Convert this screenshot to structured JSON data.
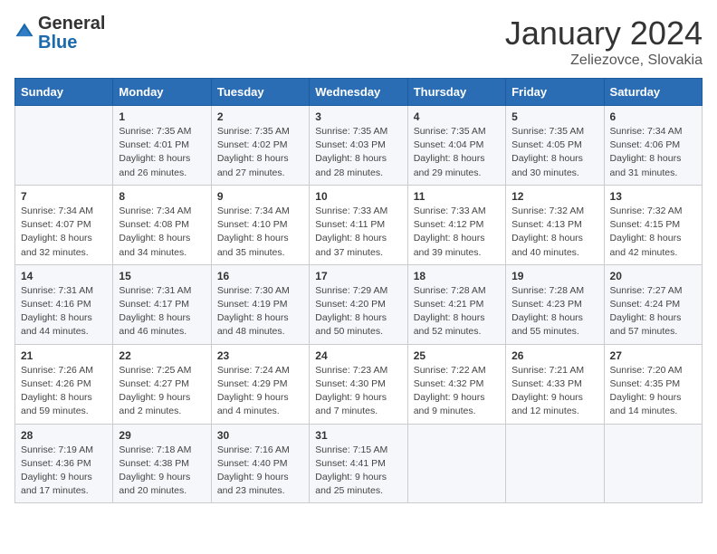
{
  "header": {
    "logo_general": "General",
    "logo_blue": "Blue",
    "month_title": "January 2024",
    "location": "Zeliezovce, Slovakia"
  },
  "days_of_week": [
    "Sunday",
    "Monday",
    "Tuesday",
    "Wednesday",
    "Thursday",
    "Friday",
    "Saturday"
  ],
  "weeks": [
    [
      {
        "day": "",
        "info": ""
      },
      {
        "day": "1",
        "info": "Sunrise: 7:35 AM\nSunset: 4:01 PM\nDaylight: 8 hours\nand 26 minutes."
      },
      {
        "day": "2",
        "info": "Sunrise: 7:35 AM\nSunset: 4:02 PM\nDaylight: 8 hours\nand 27 minutes."
      },
      {
        "day": "3",
        "info": "Sunrise: 7:35 AM\nSunset: 4:03 PM\nDaylight: 8 hours\nand 28 minutes."
      },
      {
        "day": "4",
        "info": "Sunrise: 7:35 AM\nSunset: 4:04 PM\nDaylight: 8 hours\nand 29 minutes."
      },
      {
        "day": "5",
        "info": "Sunrise: 7:35 AM\nSunset: 4:05 PM\nDaylight: 8 hours\nand 30 minutes."
      },
      {
        "day": "6",
        "info": "Sunrise: 7:34 AM\nSunset: 4:06 PM\nDaylight: 8 hours\nand 31 minutes."
      }
    ],
    [
      {
        "day": "7",
        "info": "Sunrise: 7:34 AM\nSunset: 4:07 PM\nDaylight: 8 hours\nand 32 minutes."
      },
      {
        "day": "8",
        "info": "Sunrise: 7:34 AM\nSunset: 4:08 PM\nDaylight: 8 hours\nand 34 minutes."
      },
      {
        "day": "9",
        "info": "Sunrise: 7:34 AM\nSunset: 4:10 PM\nDaylight: 8 hours\nand 35 minutes."
      },
      {
        "day": "10",
        "info": "Sunrise: 7:33 AM\nSunset: 4:11 PM\nDaylight: 8 hours\nand 37 minutes."
      },
      {
        "day": "11",
        "info": "Sunrise: 7:33 AM\nSunset: 4:12 PM\nDaylight: 8 hours\nand 39 minutes."
      },
      {
        "day": "12",
        "info": "Sunrise: 7:32 AM\nSunset: 4:13 PM\nDaylight: 8 hours\nand 40 minutes."
      },
      {
        "day": "13",
        "info": "Sunrise: 7:32 AM\nSunset: 4:15 PM\nDaylight: 8 hours\nand 42 minutes."
      }
    ],
    [
      {
        "day": "14",
        "info": "Sunrise: 7:31 AM\nSunset: 4:16 PM\nDaylight: 8 hours\nand 44 minutes."
      },
      {
        "day": "15",
        "info": "Sunrise: 7:31 AM\nSunset: 4:17 PM\nDaylight: 8 hours\nand 46 minutes."
      },
      {
        "day": "16",
        "info": "Sunrise: 7:30 AM\nSunset: 4:19 PM\nDaylight: 8 hours\nand 48 minutes."
      },
      {
        "day": "17",
        "info": "Sunrise: 7:29 AM\nSunset: 4:20 PM\nDaylight: 8 hours\nand 50 minutes."
      },
      {
        "day": "18",
        "info": "Sunrise: 7:28 AM\nSunset: 4:21 PM\nDaylight: 8 hours\nand 52 minutes."
      },
      {
        "day": "19",
        "info": "Sunrise: 7:28 AM\nSunset: 4:23 PM\nDaylight: 8 hours\nand 55 minutes."
      },
      {
        "day": "20",
        "info": "Sunrise: 7:27 AM\nSunset: 4:24 PM\nDaylight: 8 hours\nand 57 minutes."
      }
    ],
    [
      {
        "day": "21",
        "info": "Sunrise: 7:26 AM\nSunset: 4:26 PM\nDaylight: 8 hours\nand 59 minutes."
      },
      {
        "day": "22",
        "info": "Sunrise: 7:25 AM\nSunset: 4:27 PM\nDaylight: 9 hours\nand 2 minutes."
      },
      {
        "day": "23",
        "info": "Sunrise: 7:24 AM\nSunset: 4:29 PM\nDaylight: 9 hours\nand 4 minutes."
      },
      {
        "day": "24",
        "info": "Sunrise: 7:23 AM\nSunset: 4:30 PM\nDaylight: 9 hours\nand 7 minutes."
      },
      {
        "day": "25",
        "info": "Sunrise: 7:22 AM\nSunset: 4:32 PM\nDaylight: 9 hours\nand 9 minutes."
      },
      {
        "day": "26",
        "info": "Sunrise: 7:21 AM\nSunset: 4:33 PM\nDaylight: 9 hours\nand 12 minutes."
      },
      {
        "day": "27",
        "info": "Sunrise: 7:20 AM\nSunset: 4:35 PM\nDaylight: 9 hours\nand 14 minutes."
      }
    ],
    [
      {
        "day": "28",
        "info": "Sunrise: 7:19 AM\nSunset: 4:36 PM\nDaylight: 9 hours\nand 17 minutes."
      },
      {
        "day": "29",
        "info": "Sunrise: 7:18 AM\nSunset: 4:38 PM\nDaylight: 9 hours\nand 20 minutes."
      },
      {
        "day": "30",
        "info": "Sunrise: 7:16 AM\nSunset: 4:40 PM\nDaylight: 9 hours\nand 23 minutes."
      },
      {
        "day": "31",
        "info": "Sunrise: 7:15 AM\nSunset: 4:41 PM\nDaylight: 9 hours\nand 25 minutes."
      },
      {
        "day": "",
        "info": ""
      },
      {
        "day": "",
        "info": ""
      },
      {
        "day": "",
        "info": ""
      }
    ]
  ]
}
